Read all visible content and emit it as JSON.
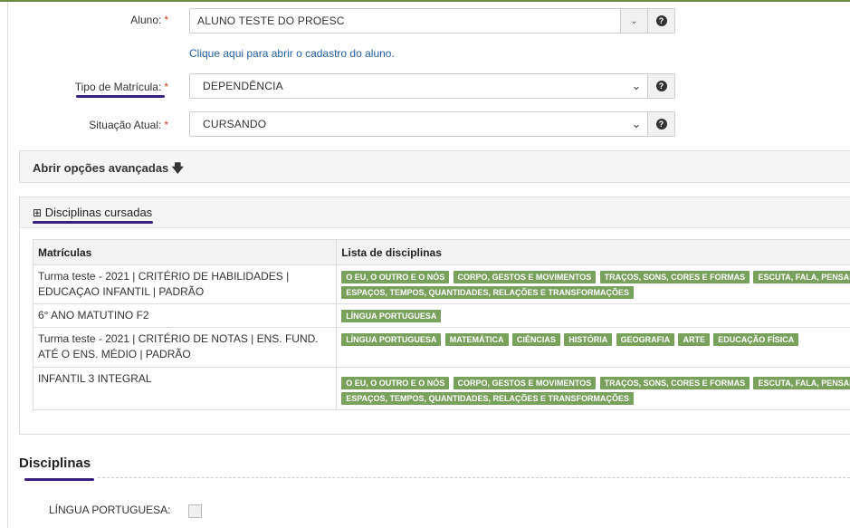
{
  "form": {
    "aluno": {
      "label": "Aluno:",
      "required": "*",
      "value": "ALUNO TESTE DO PROESC",
      "link": "Clique aqui para abrir o cadastro do aluno."
    },
    "tipo_matricula": {
      "label": "Tipo de Matrícula:",
      "required": "*",
      "value": "DEPENDÊNCIA"
    },
    "situacao": {
      "label": "Situação Atual:",
      "required": "*",
      "value": "CURSANDO"
    },
    "help_glyph": "?"
  },
  "advanced": {
    "label": "Abrir opções avançadas",
    "icon": "arrow-down-icon"
  },
  "disciplinas_cursadas": {
    "toggle": "⊞",
    "title": "Disciplinas cursadas",
    "headers": [
      "Matrículas",
      "Lista de disciplinas"
    ],
    "rows": [
      {
        "matricula": "Turma teste - 2021 | CRITÉRIO DE HABILIDADES | EDUCAÇAO INFANTIL | PADRÃO",
        "line1": [
          "O EU, O OUTRO E O NÓS",
          "CORPO, GESTOS E MOVIMENTOS",
          "TRAÇOS, SONS, CORES E FORMAS",
          "ESCUTA, FALA, PENSAMENTO E IMAGINAÇÃO"
        ],
        "line2": [
          "ESPAÇOS, TEMPOS, QUANTIDADES, RELAÇÕES E TRANSFORMAÇÕES"
        ]
      },
      {
        "matricula": "6° ANO MATUTINO F2",
        "line1": [
          "LÍNGUA PORTUGUESA"
        ],
        "line2": []
      },
      {
        "matricula": "Turma teste - 2021 | CRITÉRIO DE NOTAS | ENS. FUND. ATÉ O ENS. MÉDIO | PADRÃO",
        "line1": [
          "LÍNGUA PORTUGUESA",
          "MATEMÁTICA",
          "CIÊNCIAS",
          "HISTÓRIA",
          "GEOGRAFIA",
          "ARTE",
          "EDUCAÇÃO FÍSICA"
        ],
        "line2": []
      },
      {
        "matricula": "INFANTIL 3 INTEGRAL",
        "line1": [
          "O EU, O OUTRO E O NÓS",
          "CORPO, GESTOS E MOVIMENTOS",
          "TRAÇOS, SONS, CORES E FORMAS",
          "ESCUTA, FALA, PENSAMENTO E IMAGINAÇÃO"
        ],
        "line2": [
          "ESPAÇOS, TEMPOS, QUANTIDADES, RELAÇÕES E TRANSFORMAÇÕES"
        ]
      }
    ]
  },
  "disciplinas": {
    "title": "Disciplinas",
    "items": [
      {
        "label": "LÍNGUA PORTUGUESA:",
        "checked": false
      }
    ]
  },
  "colors": {
    "tag": "#78a15c",
    "accent_underline": "#3b1f7d",
    "link": "#1f5fa6",
    "required": "#c0392b"
  }
}
